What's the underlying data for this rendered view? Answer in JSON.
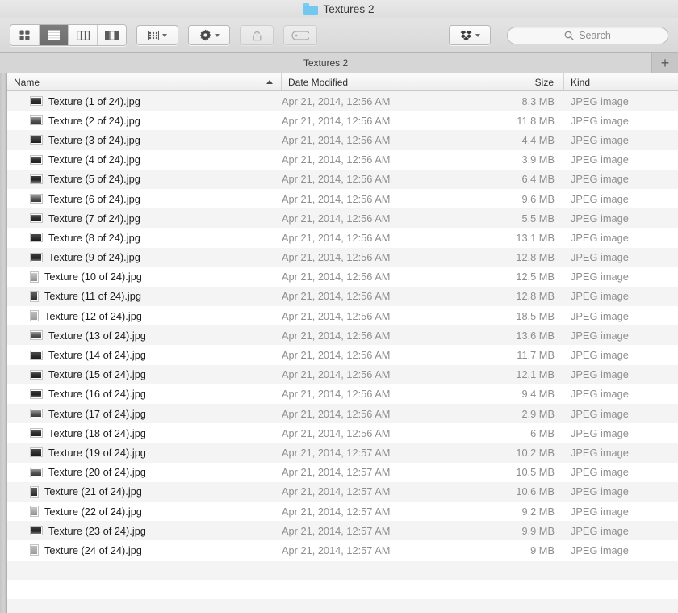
{
  "window": {
    "title": "Textures 2",
    "folder_icon": "folder-icon",
    "folder_color": "#72c8ee"
  },
  "toolbar": {
    "view_modes": [
      {
        "name": "icon-view",
        "icon": "grid-icon",
        "active": false
      },
      {
        "name": "list-view",
        "icon": "list-icon",
        "active": true
      },
      {
        "name": "column-view",
        "icon": "columns-icon",
        "active": false
      },
      {
        "name": "coverflow-view",
        "icon": "coverflow-icon",
        "active": false
      }
    ],
    "arrange": {
      "name": "arrange-button",
      "icon": "arrange-grid-icon"
    },
    "action": {
      "name": "action-button",
      "icon": "gear-icon"
    },
    "share": {
      "name": "share-button",
      "icon": "share-icon",
      "enabled": false
    },
    "tag": {
      "name": "tag-button",
      "icon": "tag-icon",
      "enabled": false
    },
    "dropbox": {
      "name": "dropbox-button",
      "icon": "dropbox-icon"
    },
    "search": {
      "placeholder": "Search",
      "value": "",
      "icon": "search-icon"
    }
  },
  "tabbar": {
    "active_tab": "Textures 2",
    "new_tab_label": "+"
  },
  "columns": {
    "name": "Name",
    "date_modified": "Date Modified",
    "size": "Size",
    "kind": "Kind",
    "sorted_by": "Name",
    "sort_direction": "ascending"
  },
  "files": [
    {
      "name": "Texture (1 of 24).jpg",
      "date": "Apr 21, 2014, 12:56 AM",
      "size": "8.3 MB",
      "kind": "JPEG image",
      "orientation": "landscape",
      "thumb": "t-l1"
    },
    {
      "name": "Texture (2 of 24).jpg",
      "date": "Apr 21, 2014, 12:56 AM",
      "size": "11.8 MB",
      "kind": "JPEG image",
      "orientation": "landscape",
      "thumb": "t-l2"
    },
    {
      "name": "Texture (3 of 24).jpg",
      "date": "Apr 21, 2014, 12:56 AM",
      "size": "4.4 MB",
      "kind": "JPEG image",
      "orientation": "landscape",
      "thumb": "t-l4"
    },
    {
      "name": "Texture (4 of 24).jpg",
      "date": "Apr 21, 2014, 12:56 AM",
      "size": "3.9 MB",
      "kind": "JPEG image",
      "orientation": "landscape",
      "thumb": "t-l1"
    },
    {
      "name": "Texture (5 of 24).jpg",
      "date": "Apr 21, 2014, 12:56 AM",
      "size": "6.4 MB",
      "kind": "JPEG image",
      "orientation": "landscape",
      "thumb": "t-l3"
    },
    {
      "name": "Texture (6 of 24).jpg",
      "date": "Apr 21, 2014, 12:56 AM",
      "size": "9.6 MB",
      "kind": "JPEG image",
      "orientation": "landscape",
      "thumb": "t-l2"
    },
    {
      "name": "Texture (7 of 24).jpg",
      "date": "Apr 21, 2014, 12:56 AM",
      "size": "5.5 MB",
      "kind": "JPEG image",
      "orientation": "landscape",
      "thumb": "t-l1"
    },
    {
      "name": "Texture (8 of 24).jpg",
      "date": "Apr 21, 2014, 12:56 AM",
      "size": "13.1 MB",
      "kind": "JPEG image",
      "orientation": "landscape",
      "thumb": "t-l4"
    },
    {
      "name": "Texture (9 of 24).jpg",
      "date": "Apr 21, 2014, 12:56 AM",
      "size": "12.8 MB",
      "kind": "JPEG image",
      "orientation": "landscape",
      "thumb": "t-l3"
    },
    {
      "name": "Texture (10 of 24).jpg",
      "date": "Apr 21, 2014, 12:56 AM",
      "size": "12.5 MB",
      "kind": "JPEG image",
      "orientation": "portrait",
      "thumb": "t-p1"
    },
    {
      "name": "Texture (11 of 24).jpg",
      "date": "Apr 21, 2014, 12:56 AM",
      "size": "12.8 MB",
      "kind": "JPEG image",
      "orientation": "portrait",
      "thumb": "t-p2"
    },
    {
      "name": "Texture (12 of 24).jpg",
      "date": "Apr 21, 2014, 12:56 AM",
      "size": "18.5 MB",
      "kind": "JPEG image",
      "orientation": "portrait",
      "thumb": "t-p3"
    },
    {
      "name": "Texture (13 of 24).jpg",
      "date": "Apr 21, 2014, 12:56 AM",
      "size": "13.6 MB",
      "kind": "JPEG image",
      "orientation": "landscape",
      "thumb": "t-l2"
    },
    {
      "name": "Texture (14 of 24).jpg",
      "date": "Apr 21, 2014, 12:56 AM",
      "size": "11.7 MB",
      "kind": "JPEG image",
      "orientation": "landscape",
      "thumb": "t-l4"
    },
    {
      "name": "Texture (15 of 24).jpg",
      "date": "Apr 21, 2014, 12:56 AM",
      "size": "12.1 MB",
      "kind": "JPEG image",
      "orientation": "landscape",
      "thumb": "t-l1"
    },
    {
      "name": "Texture (16 of 24).jpg",
      "date": "Apr 21, 2014, 12:56 AM",
      "size": "9.4 MB",
      "kind": "JPEG image",
      "orientation": "landscape",
      "thumb": "t-l3"
    },
    {
      "name": "Texture (17 of 24).jpg",
      "date": "Apr 21, 2014, 12:56 AM",
      "size": "2.9 MB",
      "kind": "JPEG image",
      "orientation": "landscape",
      "thumb": "t-l2"
    },
    {
      "name": "Texture (18 of 24).jpg",
      "date": "Apr 21, 2014, 12:56 AM",
      "size": "6 MB",
      "kind": "JPEG image",
      "orientation": "landscape",
      "thumb": "t-l1"
    },
    {
      "name": "Texture (19 of 24).jpg",
      "date": "Apr 21, 2014, 12:57 AM",
      "size": "10.2 MB",
      "kind": "JPEG image",
      "orientation": "landscape",
      "thumb": "t-l4"
    },
    {
      "name": "Texture (20 of 24).jpg",
      "date": "Apr 21, 2014, 12:57 AM",
      "size": "10.5 MB",
      "kind": "JPEG image",
      "orientation": "landscape",
      "thumb": "t-l2"
    },
    {
      "name": "Texture (21 of 24).jpg",
      "date": "Apr 21, 2014, 12:57 AM",
      "size": "10.6 MB",
      "kind": "JPEG image",
      "orientation": "portrait",
      "thumb": "t-p2"
    },
    {
      "name": "Texture (22 of 24).jpg",
      "date": "Apr 21, 2014, 12:57 AM",
      "size": "9.2 MB",
      "kind": "JPEG image",
      "orientation": "portrait",
      "thumb": "t-p1"
    },
    {
      "name": "Texture (23 of 24).jpg",
      "date": "Apr 21, 2014, 12:57 AM",
      "size": "9.9 MB",
      "kind": "JPEG image",
      "orientation": "landscape",
      "thumb": "t-l3"
    },
    {
      "name": "Texture (24 of 24).jpg",
      "date": "Apr 21, 2014, 12:57 AM",
      "size": "9 MB",
      "kind": "JPEG image",
      "orientation": "portrait",
      "thumb": "t-p3"
    }
  ],
  "empty_row_count": 3
}
